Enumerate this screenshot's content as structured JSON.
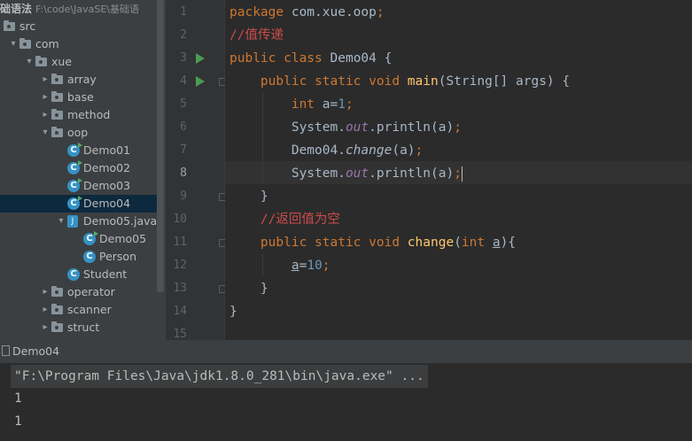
{
  "project": {
    "name": "础语法",
    "path": "F:\\code\\JavaSE\\基础语"
  },
  "tree": [
    {
      "label": "src",
      "kind": "folder",
      "indent": 0,
      "arrow": ""
    },
    {
      "label": "com",
      "kind": "folder",
      "indent": 1,
      "arrow": "▾"
    },
    {
      "label": "xue",
      "kind": "folder",
      "indent": 2,
      "arrow": "▾"
    },
    {
      "label": "array",
      "kind": "folder",
      "indent": 3,
      "arrow": "▸"
    },
    {
      "label": "base",
      "kind": "folder",
      "indent": 3,
      "arrow": "▸"
    },
    {
      "label": "method",
      "kind": "folder",
      "indent": 3,
      "arrow": "▸"
    },
    {
      "label": "oop",
      "kind": "folder",
      "indent": 3,
      "arrow": "▾"
    },
    {
      "label": "Demo01",
      "kind": "class-run",
      "indent": 4,
      "arrow": ""
    },
    {
      "label": "Demo02",
      "kind": "class-run",
      "indent": 4,
      "arrow": ""
    },
    {
      "label": "Demo03",
      "kind": "class-run",
      "indent": 4,
      "arrow": ""
    },
    {
      "label": "Demo04",
      "kind": "class-run",
      "indent": 4,
      "arrow": "",
      "selected": true
    },
    {
      "label": "Demo05.java",
      "kind": "file",
      "indent": 4,
      "arrow": "▾"
    },
    {
      "label": "Demo05",
      "kind": "class-run",
      "indent": 5,
      "arrow": ""
    },
    {
      "label": "Person",
      "kind": "class",
      "indent": 5,
      "arrow": ""
    },
    {
      "label": "Student",
      "kind": "class",
      "indent": 4,
      "arrow": ""
    },
    {
      "label": "operator",
      "kind": "folder",
      "indent": 3,
      "arrow": "▸"
    },
    {
      "label": "scanner",
      "kind": "folder",
      "indent": 3,
      "arrow": "▸"
    },
    {
      "label": "struct",
      "kind": "folder",
      "indent": 3,
      "arrow": "▸"
    }
  ],
  "editor": {
    "current_line": 8,
    "line_numbers": [
      "1",
      "2",
      "3",
      "4",
      "5",
      "6",
      "7",
      "8",
      "9",
      "10",
      "11",
      "12",
      "13",
      "14",
      "15"
    ],
    "lines": [
      [
        [
          "kw",
          "package "
        ],
        [
          "",
          "com.xue.oop"
        ],
        [
          "kw",
          ";"
        ]
      ],
      [
        [
          "cm",
          "//值传递"
        ]
      ],
      [
        [
          "kw",
          "public class "
        ],
        [
          "",
          "Demo04 {"
        ]
      ],
      [
        [
          "",
          "    "
        ],
        [
          "kw",
          "public static void "
        ],
        [
          "fn",
          "main"
        ],
        [
          "",
          "(String[] args) {"
        ]
      ],
      [
        [
          "",
          "        "
        ],
        [
          "kw",
          "int "
        ],
        [
          "",
          "a="
        ],
        [
          "num",
          "1"
        ],
        [
          "kw",
          ";"
        ]
      ],
      [
        [
          "",
          "        System."
        ],
        [
          "st",
          "out"
        ],
        [
          "",
          ".println(a)"
        ],
        [
          "kw",
          ";"
        ]
      ],
      [
        [
          "",
          "        Demo04."
        ],
        [
          "it",
          "change"
        ],
        [
          "",
          "(a)"
        ],
        [
          "kw",
          ";"
        ]
      ],
      [
        [
          "",
          "        System."
        ],
        [
          "st",
          "out"
        ],
        [
          "",
          ".println(a)"
        ],
        [
          "kw",
          ";"
        ],
        [
          "caret",
          ""
        ]
      ],
      [
        [
          "",
          "    }"
        ]
      ],
      [
        [
          "",
          "    "
        ],
        [
          "cm",
          "//返回值为空"
        ]
      ],
      [
        [
          "",
          "    "
        ],
        [
          "kw",
          "public static void "
        ],
        [
          "fn",
          "change"
        ],
        [
          "",
          "("
        ],
        [
          "kw",
          "int "
        ],
        [
          "ul",
          "a"
        ],
        [
          "",
          "){"
        ]
      ],
      [
        [
          "",
          "        "
        ],
        [
          "ul",
          "a"
        ],
        [
          "",
          "="
        ],
        [
          "num",
          "10"
        ],
        [
          "kw",
          ";"
        ]
      ],
      [
        [
          "",
          "    }"
        ]
      ],
      [
        [
          "",
          "}"
        ]
      ],
      [
        [
          "",
          ""
        ]
      ]
    ]
  },
  "run": {
    "tab_label": "Demo04",
    "command": "\"F:\\Program Files\\Java\\jdk1.8.0_281\\bin\\java.exe\" ...",
    "output": [
      "1",
      "1"
    ]
  },
  "icons": {
    "folder": "folder-icon",
    "class": "class-icon",
    "run_gutter": "run-gutter-icon",
    "fold": "fold-icon"
  }
}
